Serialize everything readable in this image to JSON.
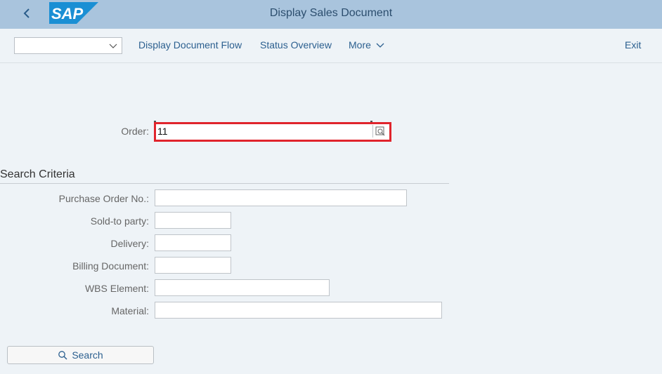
{
  "shell": {
    "title": "Display Sales Document",
    "logo_text": "SAP",
    "back_icon": "chevron-left-icon"
  },
  "toolbar": {
    "variant_select_value": "",
    "document_flow_label": "Display Document Flow",
    "status_overview_label": "Status Overview",
    "more_label": "More",
    "exit_label": "Exit"
  },
  "order": {
    "label": "Order:",
    "value": "11",
    "value_help_icon": "value-help-icon"
  },
  "search_criteria": {
    "title": "Search Criteria",
    "fields": [
      {
        "label": "Purchase Order No.:",
        "value": ""
      },
      {
        "label": "Sold-to party:",
        "value": ""
      },
      {
        "label": "Delivery:",
        "value": ""
      },
      {
        "label": "Billing Document:",
        "value": ""
      },
      {
        "label": "WBS Element:",
        "value": ""
      },
      {
        "label": "Material:",
        "value": ""
      }
    ],
    "search_button_label": "Search"
  },
  "colors": {
    "shell_background": "#a9c4dd",
    "page_background": "#eef3f7",
    "link_blue": "#2b5f8f",
    "highlight_red": "#e0242c",
    "sap_blue": "#1a8fd4"
  }
}
